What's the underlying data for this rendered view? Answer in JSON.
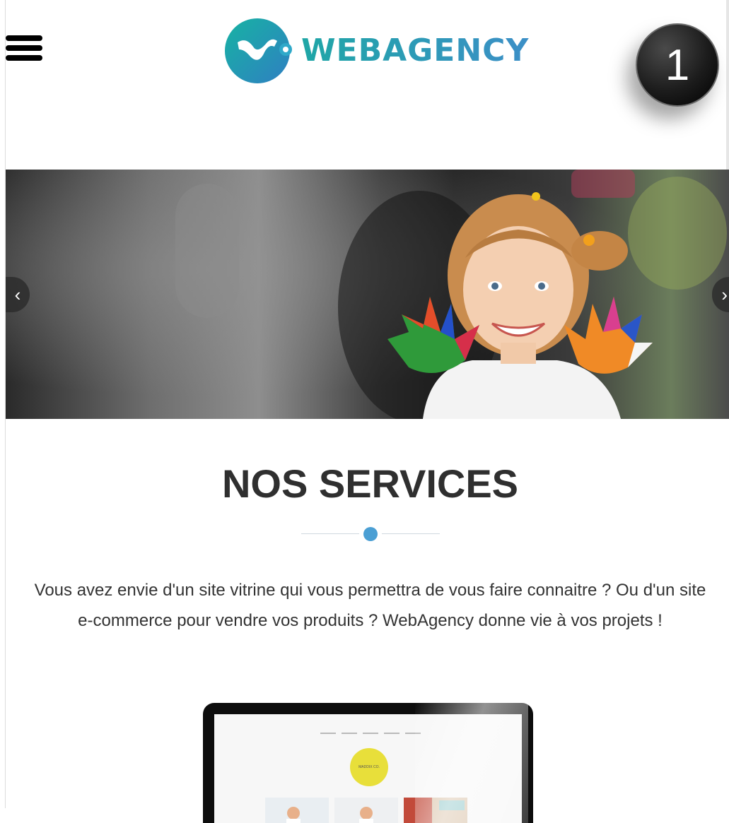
{
  "header": {
    "brand_name": "WEBAGENCY",
    "menu_icon": "hamburger-menu-icon",
    "badge_number": "1"
  },
  "hero": {
    "prev_icon": "chevron-left-icon",
    "next_icon": "chevron-right-icon",
    "prev_glyph": "‹",
    "next_glyph": "›"
  },
  "services": {
    "title": "NOS SERVICES",
    "description": "Vous avez envie d'un site vitrine qui vous permettra de vous faire connaitre ? Ou d'un site e-commerce pour vendre vos produits ? WebAgency donne vie à vos projets !"
  },
  "preview": {
    "screen_logo_text": "MADDIX CO."
  },
  "colors": {
    "brand_teal": "#1fa6a6",
    "brand_blue": "#3c8fc7",
    "divider_dot": "#4b9fd4",
    "title": "#2f2f2f"
  }
}
